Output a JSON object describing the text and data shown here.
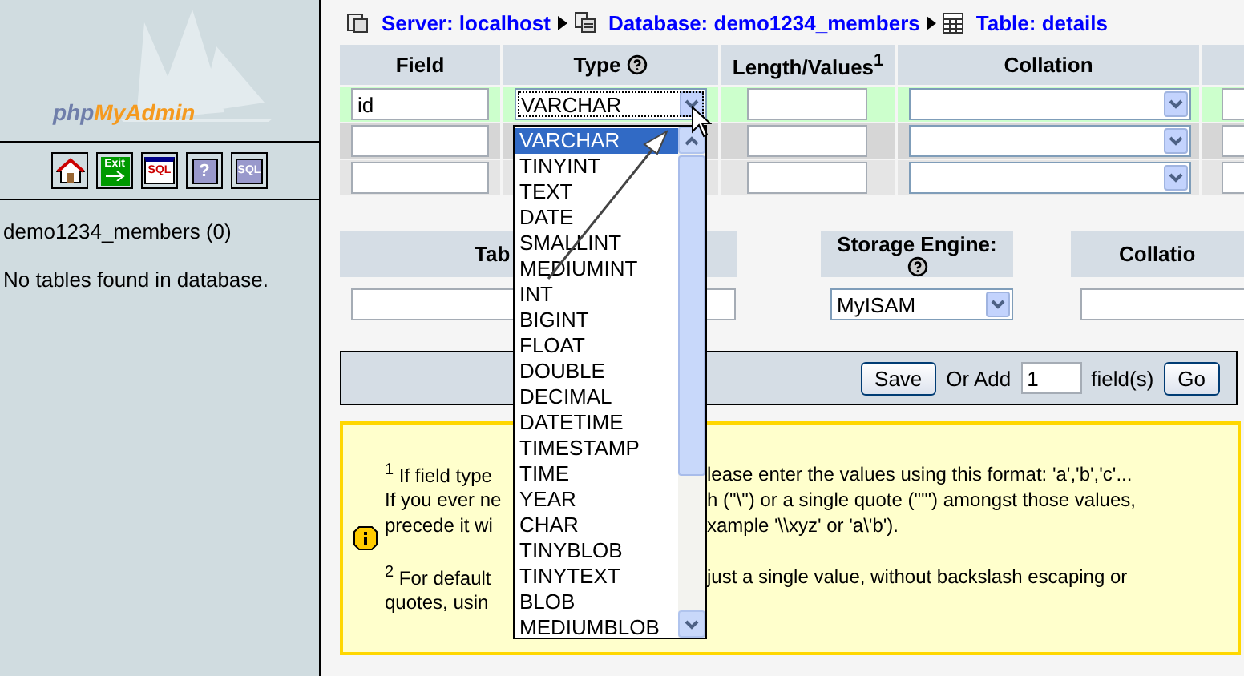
{
  "sidebar": {
    "logo": {
      "prefix": "php",
      "suffix": "MyAdmin"
    },
    "toolbar": [
      {
        "kind": "home"
      },
      {
        "kind": "exit",
        "label": "Exit"
      },
      {
        "kind": "sql-window",
        "label": "SQL"
      },
      {
        "kind": "help",
        "label": "?"
      },
      {
        "kind": "sql-chat",
        "label": "SQL"
      }
    ],
    "database": "demo1234_members (0)",
    "message": "No tables found in database."
  },
  "breadcrumb": [
    {
      "kind": "server",
      "label": "Server: localhost"
    },
    {
      "kind": "database",
      "label": "Database: demo1234_members"
    },
    {
      "kind": "table",
      "label": "Table: details"
    }
  ],
  "fields_table": {
    "columns": [
      {
        "label": "Field",
        "help": false
      },
      {
        "label": "Type",
        "help": true
      },
      {
        "label": "Length/Values$^{1}$",
        "help": false
      },
      {
        "label": "Collation",
        "help": false
      }
    ],
    "rows": [
      {
        "field": "id",
        "type": "VARCHAR",
        "active": true
      },
      {
        "active": false
      },
      {
        "active": false
      }
    ]
  },
  "type_dropdown": {
    "options": [
      {
        "label": "VARCHAR",
        "selected": true
      },
      {
        "label": "TINYINT",
        "selected": false
      },
      {
        "label": "TEXT",
        "selected": false
      },
      {
        "label": "DATE",
        "selected": false
      },
      {
        "label": "SMALLINT",
        "selected": false
      },
      {
        "label": "MEDIUMINT",
        "selected": false
      },
      {
        "label": "INT",
        "selected": false
      },
      {
        "label": "BIGINT",
        "selected": false
      },
      {
        "label": "FLOAT",
        "selected": false
      },
      {
        "label": "DOUBLE",
        "selected": false
      },
      {
        "label": "DECIMAL",
        "selected": false
      },
      {
        "label": "DATETIME",
        "selected": false
      },
      {
        "label": "TIMESTAMP",
        "selected": false
      },
      {
        "label": "TIME",
        "selected": false
      },
      {
        "label": "YEAR",
        "selected": false
      },
      {
        "label": "CHAR",
        "selected": false
      },
      {
        "label": "TINYBLOB",
        "selected": false
      },
      {
        "label": "TINYTEXT",
        "selected": false
      },
      {
        "label": "BLOB",
        "selected": false
      },
      {
        "label": "MEDIUMBLOB",
        "selected": false
      }
    ]
  },
  "table_options": {
    "comments_label": "Tab",
    "engine_label": "Storage Engine:",
    "engine": "MyISAM",
    "collation_label": "Collatio"
  },
  "actions": {
    "save": "Save",
    "or_add": "Or Add",
    "count": "1",
    "fields": "field(s)",
    "go": "Go"
  },
  "note": {
    "paragraphs": [
      [
        {
          "left": "$^{1}$ If field type",
          "right": "lease enter the values using this format: 'a','b','c'..."
        },
        {
          "left": "If you ever ne",
          "right": "h (\"\\\") or a single quote (\"'\") amongst those values,"
        },
        {
          "left": "precede it wi",
          "right": "xample '\\\\xyz' or 'a\\'b')."
        }
      ],
      [
        {
          "left": "$^{2}$ For default",
          "right": "just a single value, without backslash escaping or"
        },
        {
          "left": "quotes, usin"
        }
      ]
    ]
  }
}
